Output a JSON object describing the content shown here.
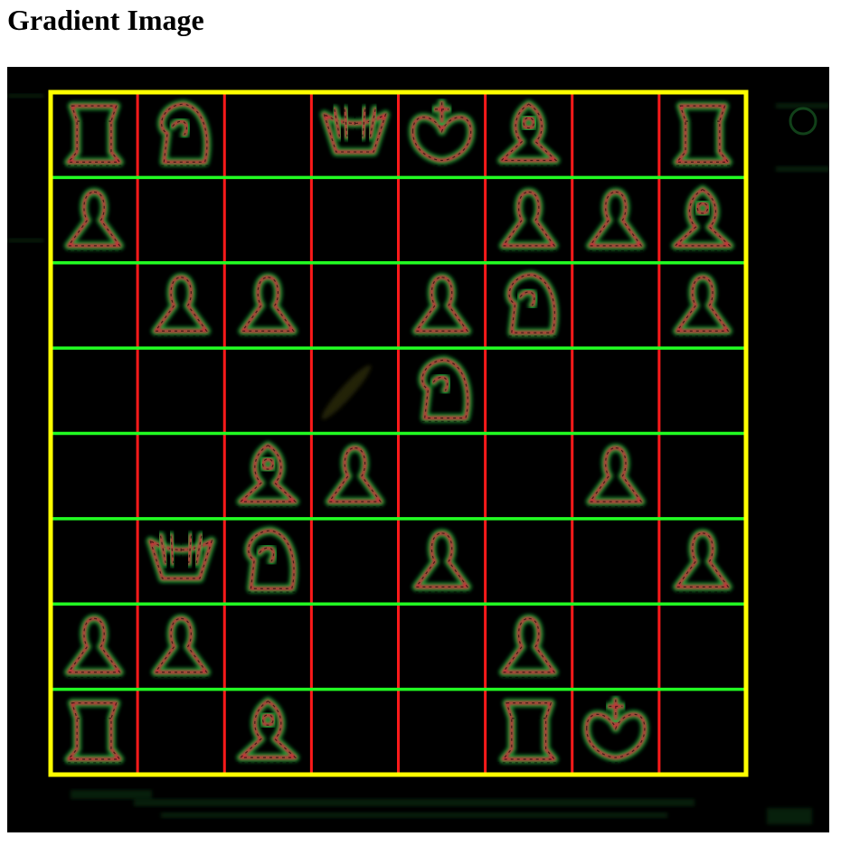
{
  "page": {
    "title": "Gradient Image"
  },
  "colors": {
    "background": "#000000",
    "board_border": "#ffff00",
    "vertical_lines": "#ff1a1a",
    "horizontal_lines": "#22ff22",
    "piece_red": "#e0203a",
    "piece_green": "#22c040"
  },
  "board": {
    "files": 8,
    "ranks": 8,
    "pieces": [
      {
        "rank": 1,
        "file": 1,
        "type": "rook"
      },
      {
        "rank": 1,
        "file": 2,
        "type": "knight"
      },
      {
        "rank": 1,
        "file": 4,
        "type": "queen"
      },
      {
        "rank": 1,
        "file": 5,
        "type": "king"
      },
      {
        "rank": 1,
        "file": 6,
        "type": "bishop"
      },
      {
        "rank": 1,
        "file": 8,
        "type": "rook"
      },
      {
        "rank": 2,
        "file": 1,
        "type": "pawn"
      },
      {
        "rank": 2,
        "file": 6,
        "type": "pawn"
      },
      {
        "rank": 2,
        "file": 7,
        "type": "pawn"
      },
      {
        "rank": 2,
        "file": 8,
        "type": "bishop"
      },
      {
        "rank": 3,
        "file": 2,
        "type": "pawn"
      },
      {
        "rank": 3,
        "file": 3,
        "type": "pawn"
      },
      {
        "rank": 3,
        "file": 5,
        "type": "pawn"
      },
      {
        "rank": 3,
        "file": 6,
        "type": "knight"
      },
      {
        "rank": 3,
        "file": 8,
        "type": "pawn"
      },
      {
        "rank": 4,
        "file": 5,
        "type": "knight"
      },
      {
        "rank": 5,
        "file": 3,
        "type": "bishop"
      },
      {
        "rank": 5,
        "file": 4,
        "type": "pawn"
      },
      {
        "rank": 5,
        "file": 7,
        "type": "pawn"
      },
      {
        "rank": 6,
        "file": 2,
        "type": "queen"
      },
      {
        "rank": 6,
        "file": 3,
        "type": "knight"
      },
      {
        "rank": 6,
        "file": 5,
        "type": "pawn"
      },
      {
        "rank": 6,
        "file": 8,
        "type": "pawn"
      },
      {
        "rank": 7,
        "file": 1,
        "type": "pawn"
      },
      {
        "rank": 7,
        "file": 2,
        "type": "pawn"
      },
      {
        "rank": 7,
        "file": 6,
        "type": "pawn"
      },
      {
        "rank": 8,
        "file": 1,
        "type": "rook"
      },
      {
        "rank": 8,
        "file": 3,
        "type": "bishop"
      },
      {
        "rank": 8,
        "file": 6,
        "type": "rook"
      },
      {
        "rank": 8,
        "file": 7,
        "type": "king"
      }
    ]
  }
}
